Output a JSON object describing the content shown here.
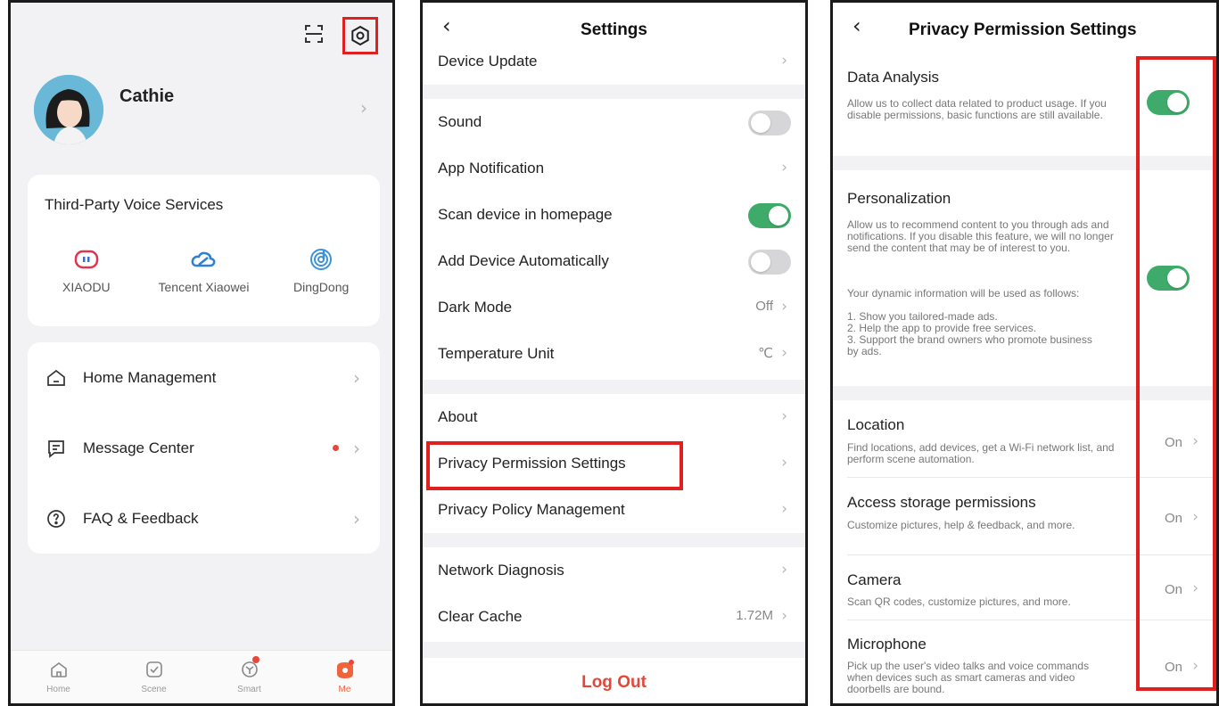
{
  "me_screen": {
    "profile_name": "Cathie",
    "voice_title": "Third-Party Voice Services",
    "voice_services": [
      {
        "label": "XIAODU",
        "icon": "xiaodu-icon"
      },
      {
        "label": "Tencent Xiaowei",
        "icon": "cloud-icon"
      },
      {
        "label": "DingDong",
        "icon": "dingdong-icon"
      }
    ],
    "menu": [
      {
        "label": "Home Management",
        "icon": "home-outline-icon"
      },
      {
        "label": "Message Center",
        "icon": "message-icon",
        "dot": true
      },
      {
        "label": "FAQ & Feedback",
        "icon": "question-icon"
      }
    ],
    "nav": [
      {
        "label": "Home"
      },
      {
        "label": "Scene"
      },
      {
        "label": "Smart"
      },
      {
        "label": "Me",
        "active": true
      }
    ]
  },
  "settings_screen": {
    "title": "Settings",
    "rows": {
      "device_update": "Device Update",
      "sound": "Sound",
      "app_notification": "App Notification",
      "scan_device": "Scan device in homepage",
      "add_device_auto": "Add Device Automatically",
      "dark_mode": "Dark Mode",
      "dark_mode_value": "Off",
      "temp_unit": "Temperature Unit",
      "temp_unit_value": "℃",
      "about": "About",
      "privacy_permission": "Privacy Permission Settings",
      "privacy_policy": "Privacy Policy Management",
      "network_diagnosis": "Network Diagnosis",
      "clear_cache": "Clear Cache",
      "clear_cache_value": "1.72M"
    },
    "toggles": {
      "sound": false,
      "scan_device": true,
      "add_device_auto": false
    },
    "logout": "Log Out"
  },
  "privacy_screen": {
    "title": "Privacy Permission Settings",
    "data_analysis": {
      "title": "Data Analysis",
      "desc": "Allow us to collect data related to product usage. If you disable permissions, basic functions are still available.",
      "enabled": true
    },
    "personalization": {
      "title": "Personalization",
      "desc": "Allow us to recommend content to you through ads and notifications. If you disable this feature, we will no longer send the content that may be of interest to you.",
      "desc2_intro": "Your dynamic information will be used as follows:",
      "desc2_1": "1. Show you tailored-made ads.",
      "desc2_2": "2. Help the app to provide free services.",
      "desc2_3": "3. Support the brand owners who promote business by ads.",
      "enabled": true
    },
    "location": {
      "title": "Location",
      "desc": "Find locations, add devices, get a Wi-Fi network list, and perform scene automation.",
      "value": "On"
    },
    "storage": {
      "title": "Access storage permissions",
      "desc": "Customize pictures, help & feedback, and more.",
      "value": "On"
    },
    "camera": {
      "title": "Camera",
      "desc": "Scan QR codes, customize pictures, and more.",
      "value": "On"
    },
    "microphone": {
      "title": "Microphone",
      "desc": "Pick up the user's video talks and voice commands when devices such as smart cameras and video doorbells are bound.",
      "value": "On"
    }
  },
  "colors": {
    "highlight": "#e0201f",
    "toggle_on": "#3fab6a",
    "accent": "#f0643c",
    "logout": "#e3473a"
  }
}
